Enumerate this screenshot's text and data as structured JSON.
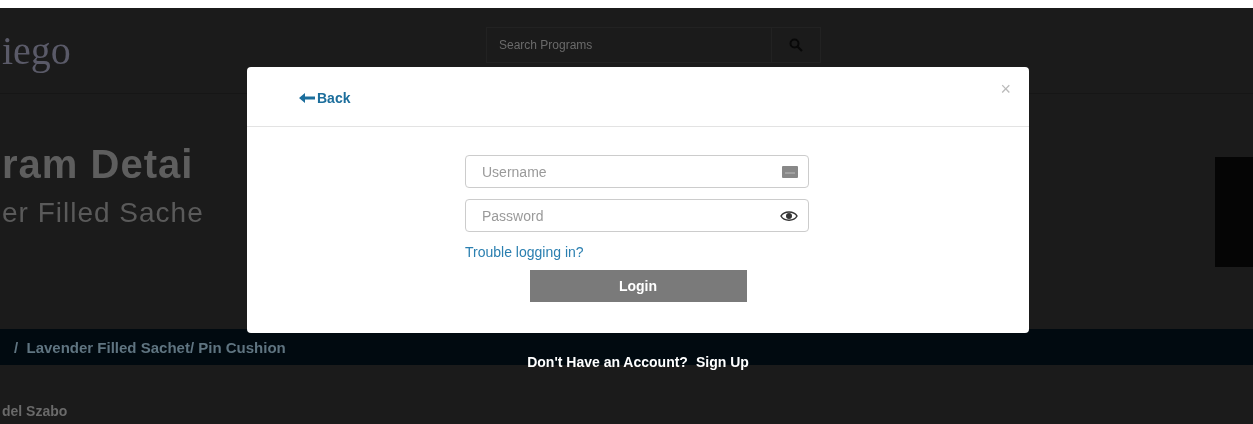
{
  "header": {
    "logo": "iego",
    "search": {
      "placeholder": "Search Programs"
    }
  },
  "page": {
    "title": "ram Detai",
    "subtitle": "er Filled Sache",
    "breadcrumb": "/  Lavender Filled Sachet/ Pin Cushion",
    "author": "del Szabo"
  },
  "modal": {
    "back": "Back",
    "close": "×",
    "username": {
      "placeholder": "Username"
    },
    "password": {
      "placeholder": "Password"
    },
    "trouble_link": "Trouble logging in?",
    "login_button": "Login"
  },
  "signup": {
    "prompt": "Don't Have an Account?",
    "link": "Sign Up"
  }
}
